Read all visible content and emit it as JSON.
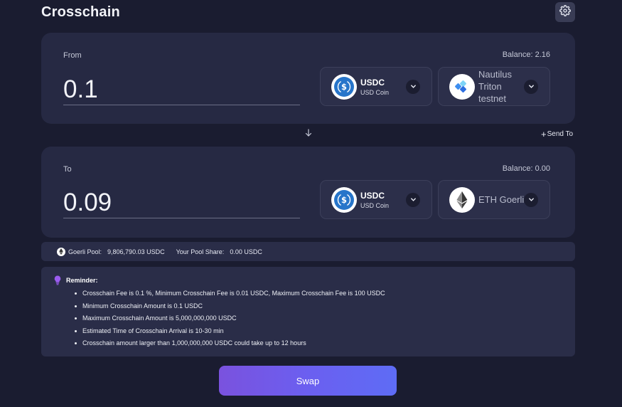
{
  "header": {
    "title": "Crosschain"
  },
  "from": {
    "label": "From",
    "balance": "Balance: 2.16",
    "amount": "0.1",
    "token": {
      "symbol": "USDC",
      "name": "USD Coin"
    },
    "chain": {
      "name": "Nautilus Triton testnet"
    }
  },
  "actions": {
    "send_to": "Send To"
  },
  "to": {
    "label": "To",
    "balance": "Balance: 0.00",
    "amount": "0.09",
    "token": {
      "symbol": "USDC",
      "name": "USD Coin"
    },
    "chain": {
      "name": "ETH Goerli"
    }
  },
  "pool": {
    "label": "Goerli Pool:",
    "value": "9,806,790.03 USDC",
    "share_label": "Your Pool Share:",
    "share_value": "0.00 USDC"
  },
  "reminder": {
    "title": "Reminder:",
    "items": [
      "Crosschain Fee is 0.1 %, Minimum Crosschain Fee is 0.01 USDC, Maximum Crosschain Fee is 100 USDC",
      "Minimum Crosschain Amount is 0.1 USDC",
      "Maximum Crosschain Amount is 5,000,000,000 USDC",
      "Estimated Time of Crosschain Arrival is 10-30 min",
      "Crosschain amount larger than 1,000,000,000 USDC could take up to 12 hours"
    ]
  },
  "swap_button": {
    "label": "Swap"
  },
  "icons": {
    "settings": "gear-icon",
    "usdc": "usdc-icon",
    "nautilus": "nautilus-icon",
    "eth": "ethereum-icon",
    "chevron": "chevron-down-icon",
    "arrow": "arrow-down-icon",
    "plus": "plus-icon",
    "bulb": "lightbulb-icon"
  },
  "colors": {
    "background": "#1a1c30",
    "card": "#262943",
    "accent_start": "#7a52de",
    "accent_end": "#5e6cf5",
    "usdc_blue": "#2775ca"
  }
}
